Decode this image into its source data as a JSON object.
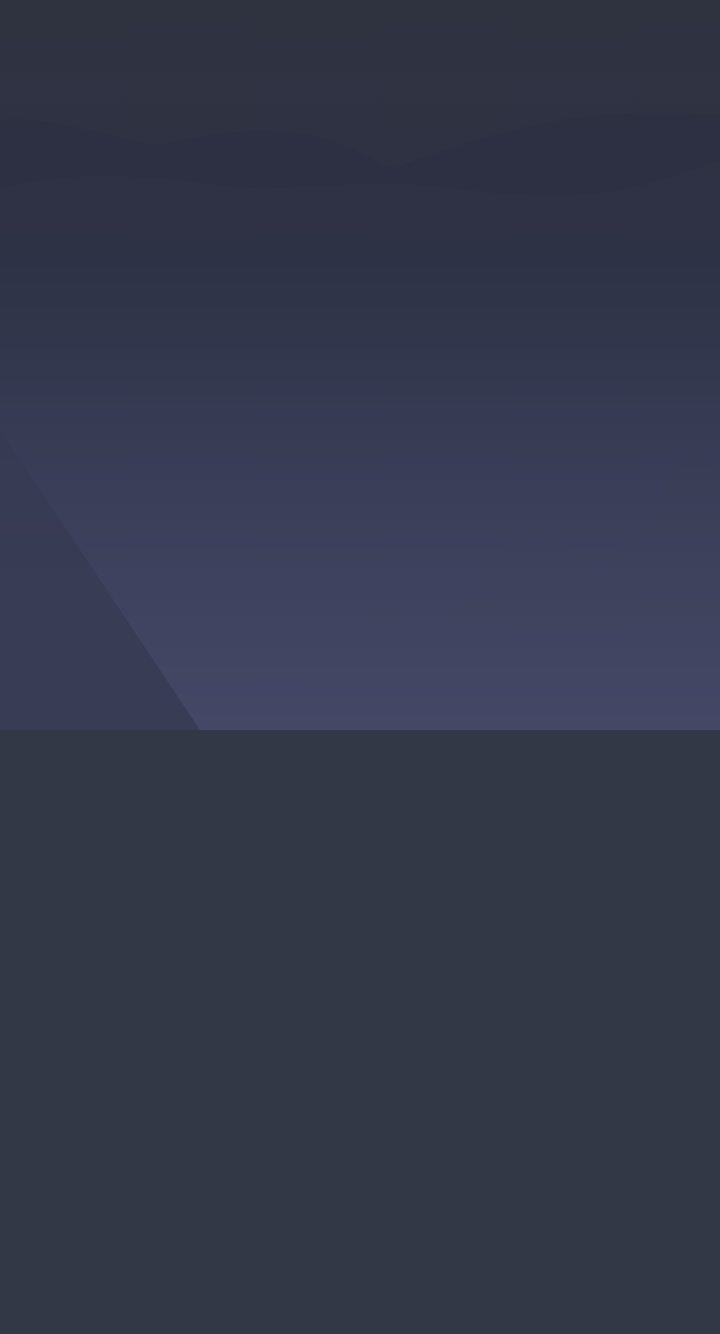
{
  "scene": {
    "sky_top_color": "#2f3340",
    "sky_mid_color": "#343851",
    "sky_bottom_color": "#444866",
    "ground_color": "#323845",
    "ridge_color": "#2c3042",
    "mountain_color": "#383c53"
  }
}
